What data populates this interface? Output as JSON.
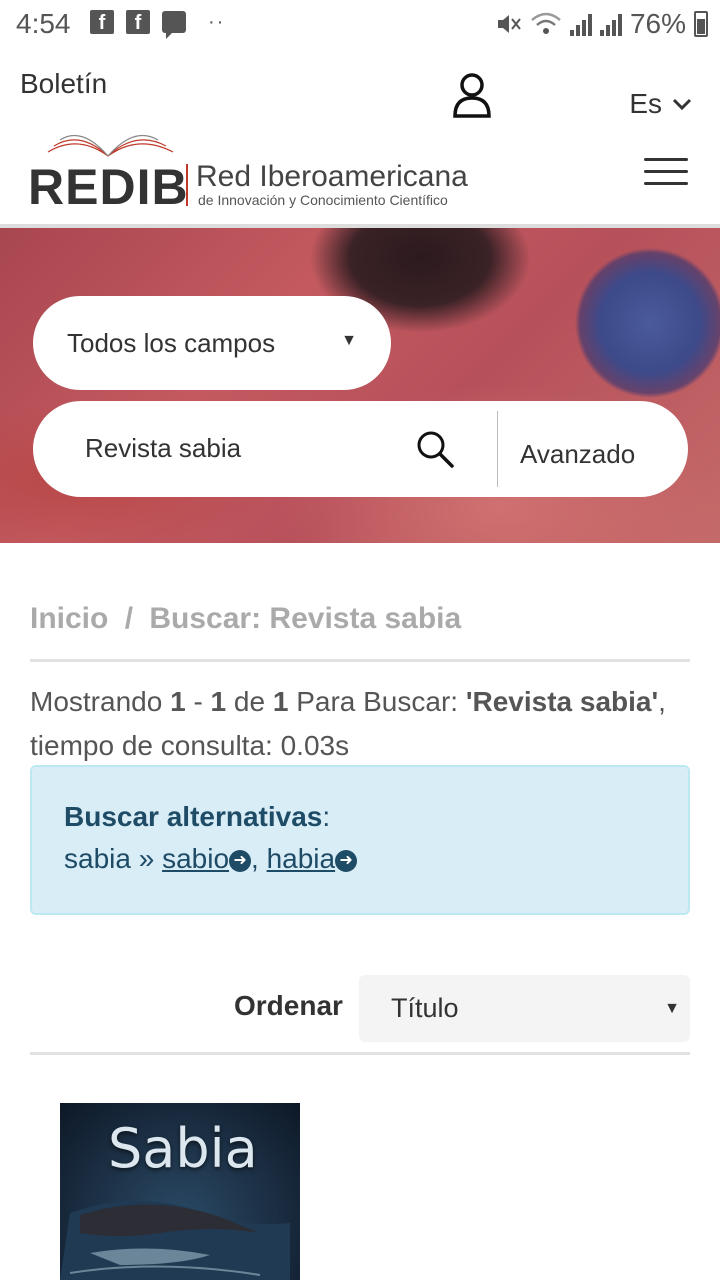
{
  "statusbar": {
    "time": "4:54",
    "battery": "76%"
  },
  "header": {
    "boletin": "Boletín",
    "lang": "Es",
    "logo_main": "REDIB",
    "logo_title": "Red Iberoamericana",
    "logo_subtitle": "de Innovación y Conocimiento Científico"
  },
  "search": {
    "field_select": "Todos los campos",
    "query": "Revista sabia",
    "advanced": "Avanzado"
  },
  "breadcrumb": {
    "home": "Inicio",
    "sep": "/",
    "current": "Buscar: Revista sabia"
  },
  "summary": {
    "showing": "Mostrando",
    "from": "1",
    "dash": "-",
    "to": "1",
    "of": "de",
    "total": "1",
    "para": "Para Buscar:",
    "term": "'Revista sabia'",
    "time_text": ", tiempo de consulta: 0.03s"
  },
  "alternatives": {
    "title": "Buscar alternativas",
    "colon": ":",
    "word": "sabia",
    "arrow": "»",
    "suggestions": [
      "sabio",
      "habia"
    ]
  },
  "sort": {
    "label": "Ordenar",
    "value": "Título"
  },
  "result": {
    "cover_title": "Sabia"
  }
}
